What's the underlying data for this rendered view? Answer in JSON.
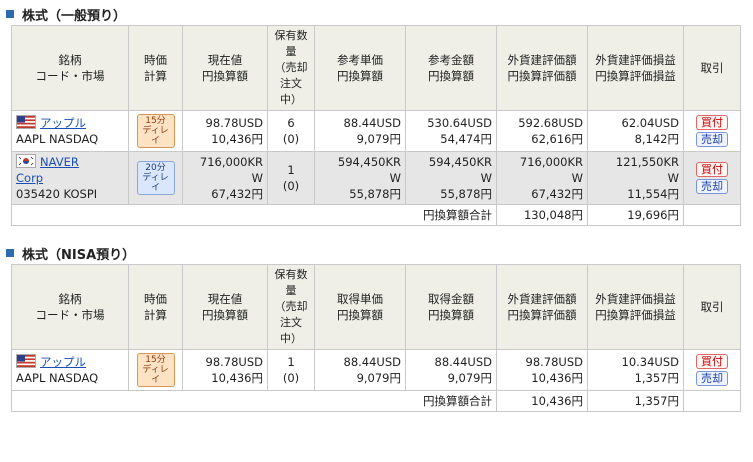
{
  "section1": {
    "title": "株式（一般預り）",
    "headers": [
      "銘柄\nコード・市場",
      "時価\n計算",
      "現在値\n円換算額",
      "保有数\n量\n（売却\n注文\n中）",
      "参考単価\n円換算額",
      "参考金額\n円換算額",
      "外貨建評価額\n円換算評価額",
      "外貨建評価損益\n円換算評価損益",
      "取引"
    ],
    "rows": [
      {
        "name": "アップル",
        "code": "AAPL NASDAQ",
        "flag": "US",
        "delay": "15分\nディレイ",
        "price": "98.78USD",
        "price_jpy": "10,436円",
        "qty": "6",
        "qty_order": "(0)",
        "unit": "88.44USD",
        "unit_jpy": "9,079円",
        "amount": "530.64USD",
        "amount_jpy": "54,474円",
        "eval": "592.68USD",
        "eval_jpy": "62,616円",
        "pl": "62.04USD",
        "pl_jpy": "8,142円",
        "buy": "買付",
        "sell": "売却"
      },
      {
        "name": "NAVER\nCorp",
        "code": "035420 KOSPI",
        "flag": "KR",
        "delay": "20分\nディレイ",
        "price": "716,000KR\nW",
        "price_jpy": "67,432円",
        "qty": "1",
        "qty_order": "(0)",
        "unit": "594,450KR\nW",
        "unit_jpy": "55,878円",
        "amount": "594,450KR\nW",
        "amount_jpy": "55,878円",
        "eval": "716,000KR\nW",
        "eval_jpy": "67,432円",
        "pl": "121,550KR\nW",
        "pl_jpy": "11,554円",
        "buy": "買付",
        "sell": "売却"
      }
    ],
    "total_label": "円換算額合計",
    "total_eval": "130,048円",
    "total_pl": "19,696円"
  },
  "section2": {
    "title": "株式（NISA預り）",
    "headers": [
      "銘柄\nコード・市場",
      "時価\n計算",
      "現在値\n円換算額",
      "保有数\n量\n（売却\n注文\n中）",
      "取得単価\n円換算額",
      "取得金額\n円換算額",
      "外貨建評価額\n円換算評価額",
      "外貨建評価損益\n円換算評価損益",
      "取引"
    ],
    "rows": [
      {
        "name": "アップル",
        "code": "AAPL NASDAQ",
        "flag": "US",
        "delay": "15分\nディレイ",
        "price": "98.78USD",
        "price_jpy": "10,436円",
        "qty": "1",
        "qty_order": "(0)",
        "unit": "88.44USD",
        "unit_jpy": "9,079円",
        "amount": "88.44USD",
        "amount_jpy": "9,079円",
        "eval": "98.78USD",
        "eval_jpy": "10,436円",
        "pl": "10.34USD",
        "pl_jpy": "1,357円",
        "buy": "買付",
        "sell": "売却"
      }
    ],
    "total_label": "円換算額合計",
    "total_eval": "10,436円",
    "total_pl": "1,357円"
  }
}
